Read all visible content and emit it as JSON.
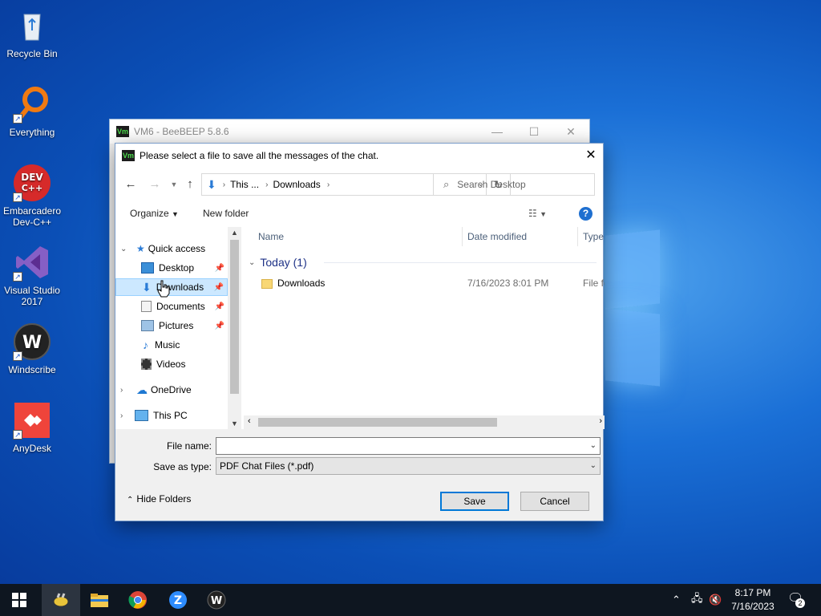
{
  "desktop": {
    "icons": [
      {
        "label": "Recycle Bin"
      },
      {
        "label": "Everything"
      },
      {
        "label": "Embarcadero Dev-C++"
      },
      {
        "label": "Visual Studio 2017"
      },
      {
        "label": "Windscribe"
      },
      {
        "label": "AnyDesk"
      }
    ]
  },
  "bg_window": {
    "title": "VM6 - BeeBEEP 5.8.6",
    "app_badge": "Vm"
  },
  "dialog": {
    "app_badge": "Vm",
    "title": "Please select a file to save all the messages of the chat.",
    "address": {
      "crumb1": "This ...",
      "crumb2": "Downloads"
    },
    "search_placeholder": "Search Desktop",
    "toolbar": {
      "organize": "Organize",
      "new_folder": "New folder"
    },
    "nav_pane": {
      "quick_access": "Quick access",
      "items": [
        {
          "label": "Desktop",
          "pinned": true
        },
        {
          "label": "Downloads",
          "pinned": true,
          "selected": true
        },
        {
          "label": "Documents",
          "pinned": true
        },
        {
          "label": "Pictures",
          "pinned": true
        },
        {
          "label": "Music"
        },
        {
          "label": "Videos"
        }
      ],
      "onedrive": "OneDrive",
      "this_pc": "This PC"
    },
    "columns": {
      "name": "Name",
      "date_modified": "Date modified",
      "type": "Type"
    },
    "group": {
      "label": "Today (1)"
    },
    "files": [
      {
        "name": "Downloads",
        "date": "7/16/2023 8:01 PM",
        "type": "File fo"
      }
    ],
    "file_name_label": "File name:",
    "file_name_value": "",
    "save_type_label": "Save as type:",
    "save_type_value": "PDF Chat Files (*.pdf)",
    "hide_folders": "Hide Folders",
    "save_button": "Save",
    "cancel_button": "Cancel"
  },
  "taskbar": {
    "clock_time": "8:17 PM",
    "clock_date": "7/16/2023",
    "notification_count": "2"
  },
  "colors": {
    "accent": "#0078d7",
    "selection": "#cce8ff",
    "taskbar": "#0e1620"
  }
}
